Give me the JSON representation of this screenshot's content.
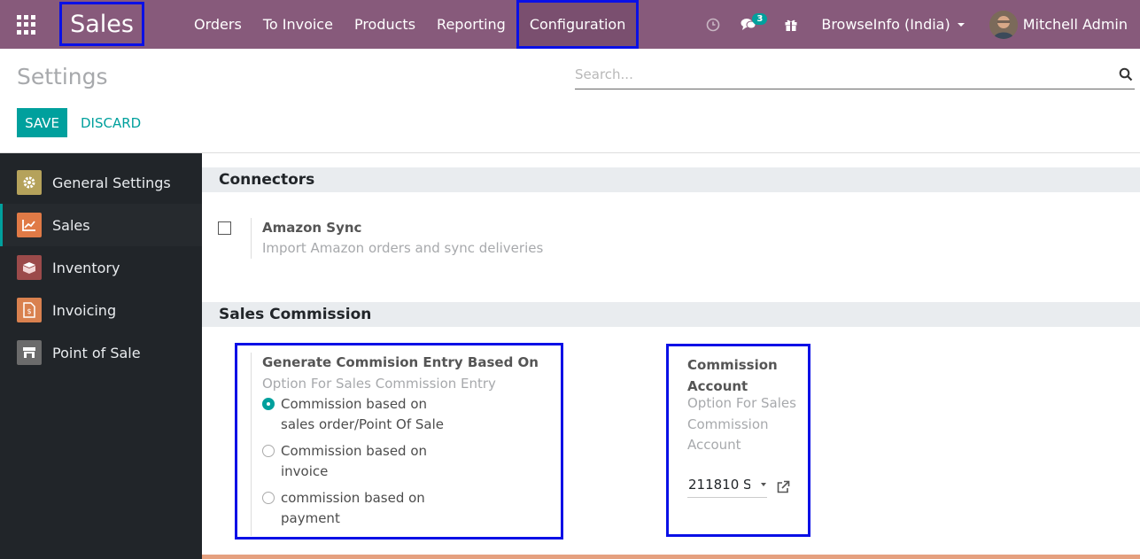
{
  "navbar": {
    "brand": "Sales",
    "menu": [
      "Orders",
      "To Invoice",
      "Products",
      "Reporting",
      "Configuration"
    ],
    "chat_badge": "3",
    "company": "BrowseInfo (India)",
    "user": "Mitchell Admin"
  },
  "control": {
    "title": "Settings",
    "search_placeholder": "Search...",
    "save_label": "SAVE",
    "discard_label": "DISCARD"
  },
  "sidebar": {
    "items": [
      {
        "label": "General Settings",
        "color": "#b5a25b"
      },
      {
        "label": "Sales",
        "color": "#e07a46"
      },
      {
        "label": "Inventory",
        "color": "#9b4a4a"
      },
      {
        "label": "Invoicing",
        "color": "#d9814f"
      },
      {
        "label": "Point of Sale",
        "color": "#6b6b6b"
      }
    ]
  },
  "connectors": {
    "heading": "Connectors",
    "amazon_title": "Amazon Sync",
    "amazon_desc": "Import Amazon orders and sync deliveries"
  },
  "commission": {
    "heading": "Sales Commission",
    "entry_title": "Generate Commision Entry Based On",
    "entry_desc": "Option For Sales Commission Entry",
    "options": [
      {
        "line1": "Commission based on",
        "line2": "sales order/Point Of Sale",
        "checked": true
      },
      {
        "line1": "Commission based on",
        "line2": "invoice",
        "checked": false
      },
      {
        "line1": "commission based on",
        "line2": "payment",
        "checked": false
      }
    ],
    "account_title_1": "Commission",
    "account_title_2": "Account",
    "account_desc_1": "Option For Sales",
    "account_desc_2": "Commission",
    "account_desc_3": "Account",
    "account_value": "211810 S"
  },
  "colors": {
    "navbar": "#875a7b",
    "accent": "#00a09d",
    "highlight_box": "#0a10e6",
    "sidebar_bg": "#212529"
  }
}
